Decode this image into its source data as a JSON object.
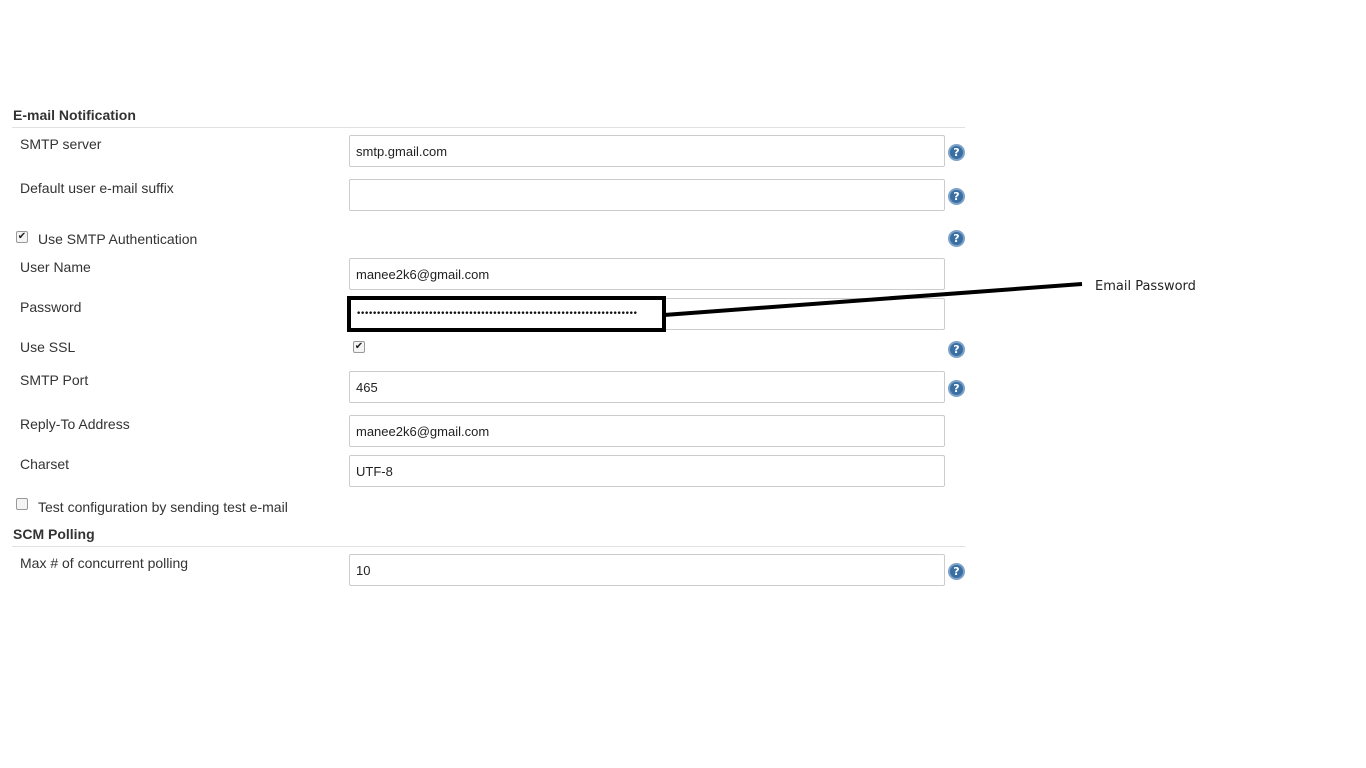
{
  "email_notification": {
    "title": "E-mail Notification",
    "smtp_server": {
      "label": "SMTP server",
      "value": "smtp.gmail.com"
    },
    "default_suffix": {
      "label": "Default user e-mail suffix",
      "value": ""
    },
    "use_smtp_auth": {
      "label": "Use SMTP Authentication",
      "checked": true
    },
    "user_name": {
      "label": "User Name",
      "value": "manee2k6@gmail.com"
    },
    "password": {
      "label": "Password",
      "masked_value": "••••••••••••••••••••••••••••••••••••••••••••••••••••••••••••••••••••••"
    },
    "use_ssl": {
      "label": "Use SSL",
      "checked": true
    },
    "smtp_port": {
      "label": "SMTP Port",
      "value": "465"
    },
    "reply_to": {
      "label": "Reply-To Address",
      "value": "manee2k6@gmail.com"
    },
    "charset": {
      "label": "Charset",
      "value": "UTF-8"
    },
    "test_config": {
      "label": "Test configuration by sending test e-mail",
      "checked": false
    }
  },
  "scm_polling": {
    "title": "SCM Polling",
    "max_concurrent": {
      "label": "Max # of concurrent polling",
      "value": "10"
    }
  },
  "annotation": {
    "text": "Email Password"
  },
  "icons": {
    "help": "help-icon",
    "check": "checkmark"
  },
  "colors": {
    "help_icon": "#3a6fa3",
    "border": "#cccccc",
    "annotation": "#000000"
  }
}
